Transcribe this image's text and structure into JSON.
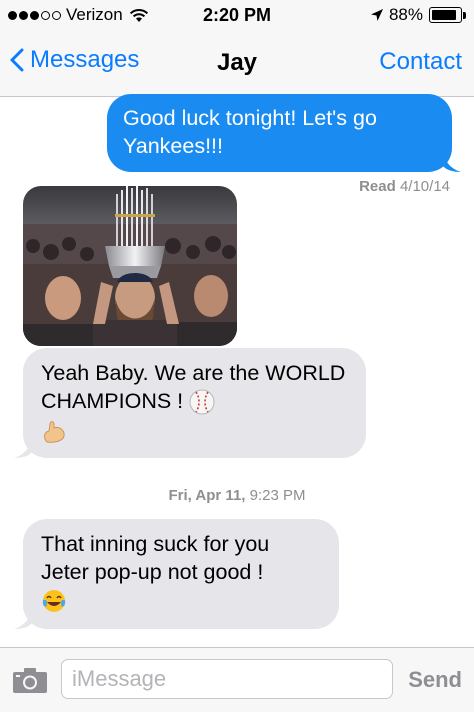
{
  "status_bar": {
    "carrier": "Verizon",
    "time": "2:20 PM",
    "battery_percent": "88%",
    "battery_level": 0.88,
    "signal_bars_filled": 3,
    "signal_bars_total": 5,
    "icons": [
      "signal-dots-icon",
      "wifi-icon",
      "location-arrow-icon",
      "battery-icon"
    ]
  },
  "nav": {
    "back_label": "Messages",
    "title": "Jay",
    "contact_label": "Contact"
  },
  "messages": {
    "sent_1": "Good luck tonight! Let's go Yankees!!!",
    "read_label": "Read",
    "read_date": "4/10/14",
    "photo_description_icon": "photo-trophy-celebration",
    "received_1_text": "Yeah Baby. We are the WORLD CHAMPIONS !",
    "received_1_emojis": [
      "baseball-emoji",
      "flexed-biceps-emoji"
    ],
    "date_divider_day": "Fri, Apr 11,",
    "date_divider_time": "9:23 PM",
    "received_2_line1": "That inning suck for you",
    "received_2_line2": "Jeter pop-up not good !",
    "received_2_emojis": [
      "tears-of-joy-emoji"
    ]
  },
  "input_bar": {
    "placeholder": "iMessage",
    "send_label": "Send"
  },
  "colors": {
    "accent": "#0a7cff",
    "sent_bubble": "#1a8cf1",
    "received_bubble": "#e5e5ea",
    "meta_text": "#8e8e93"
  }
}
